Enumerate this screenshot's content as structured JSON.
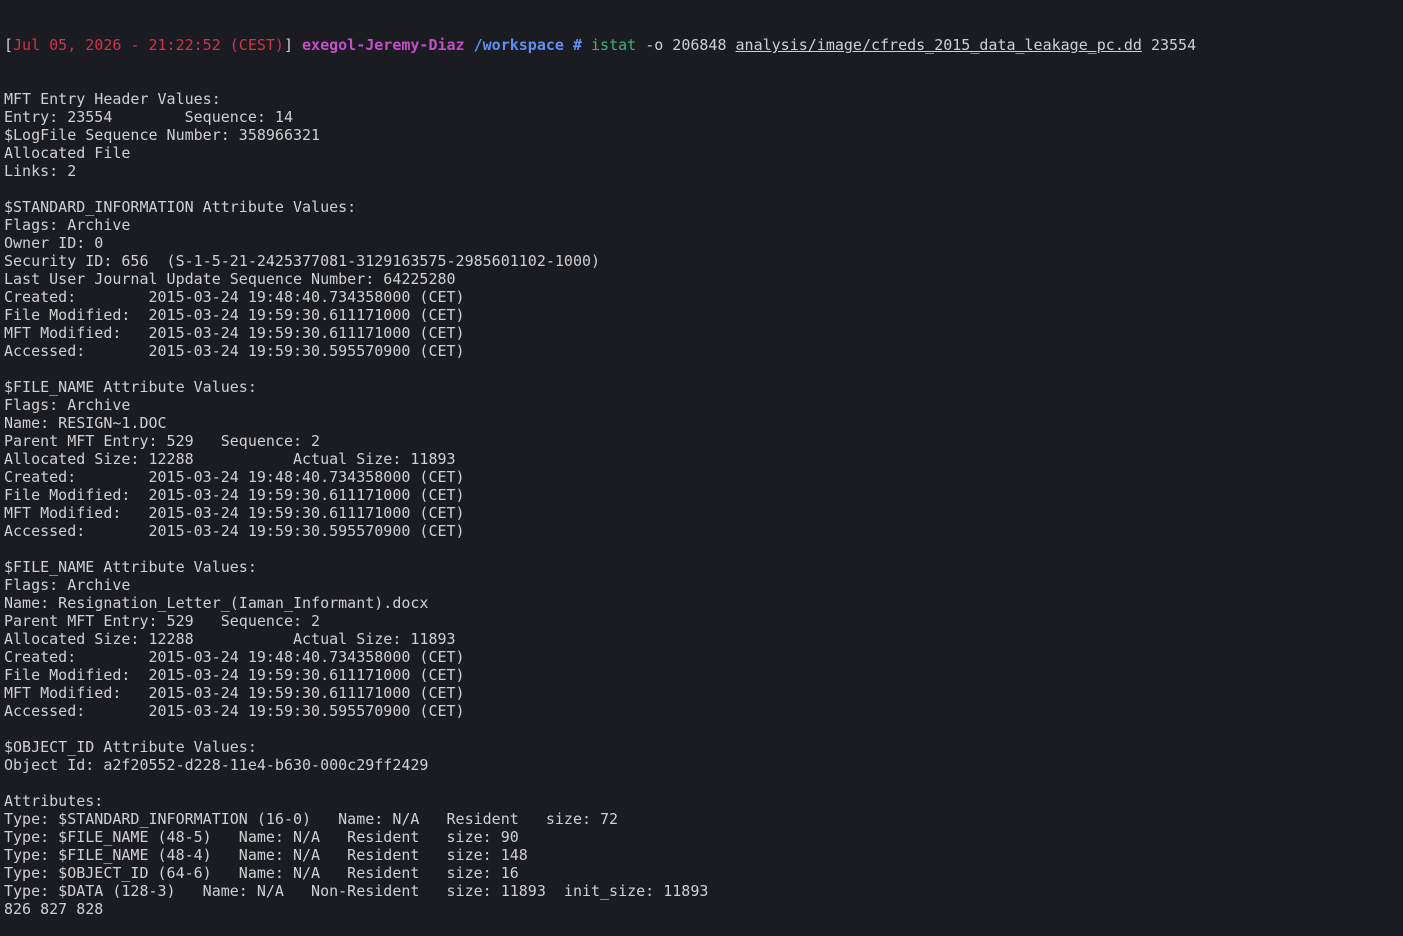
{
  "prompt": {
    "open_bracket": "[",
    "datetime": "Jul 05, 2026 - 21:22:52 (CEST)",
    "close_bracket": "]",
    "host": "exegol-Jeremy-Diaz",
    "cwd": "/workspace #",
    "command": "istat",
    "options": "-o 206848",
    "image_path": "analysis/image/cfreds_2015_data_leakage_pc.dd",
    "inode": "23554"
  },
  "colors": {
    "background": "#1b1c22",
    "text": "#d0d0d0",
    "date": "#d2324b",
    "host": "#c54ec7",
    "path": "#5e8ff5",
    "command": "#3db37a"
  },
  "output_lines": [
    "MFT Entry Header Values:",
    "Entry: 23554        Sequence: 14",
    "$LogFile Sequence Number: 358966321",
    "Allocated File",
    "Links: 2",
    "",
    "$STANDARD_INFORMATION Attribute Values:",
    "Flags: Archive",
    "Owner ID: 0",
    "Security ID: 656  (S-1-5-21-2425377081-3129163575-2985601102-1000)",
    "Last User Journal Update Sequence Number: 64225280",
    "Created:        2015-03-24 19:48:40.734358000 (CET)",
    "File Modified:  2015-03-24 19:59:30.611171000 (CET)",
    "MFT Modified:   2015-03-24 19:59:30.611171000 (CET)",
    "Accessed:       2015-03-24 19:59:30.595570900 (CET)",
    "",
    "$FILE_NAME Attribute Values:",
    "Flags: Archive",
    "Name: RESIGN~1.DOC",
    "Parent MFT Entry: 529   Sequence: 2",
    "Allocated Size: 12288           Actual Size: 11893",
    "Created:        2015-03-24 19:48:40.734358000 (CET)",
    "File Modified:  2015-03-24 19:59:30.611171000 (CET)",
    "MFT Modified:   2015-03-24 19:59:30.611171000 (CET)",
    "Accessed:       2015-03-24 19:59:30.595570900 (CET)",
    "",
    "$FILE_NAME Attribute Values:",
    "Flags: Archive",
    "Name: Resignation_Letter_(Iaman_Informant).docx",
    "Parent MFT Entry: 529   Sequence: 2",
    "Allocated Size: 12288           Actual Size: 11893",
    "Created:        2015-03-24 19:48:40.734358000 (CET)",
    "File Modified:  2015-03-24 19:59:30.611171000 (CET)",
    "MFT Modified:   2015-03-24 19:59:30.611171000 (CET)",
    "Accessed:       2015-03-24 19:59:30.595570900 (CET)",
    "",
    "$OBJECT_ID Attribute Values:",
    "Object Id: a2f20552-d228-11e4-b630-000c29ff2429",
    "",
    "Attributes:",
    "Type: $STANDARD_INFORMATION (16-0)   Name: N/A   Resident   size: 72",
    "Type: $FILE_NAME (48-5)   Name: N/A   Resident   size: 90",
    "Type: $FILE_NAME (48-4)   Name: N/A   Resident   size: 148",
    "Type: $OBJECT_ID (64-6)   Name: N/A   Resident   size: 16",
    "Type: $DATA (128-3)   Name: N/A   Non-Resident   size: 11893  init_size: 11893",
    "826 827 828"
  ]
}
